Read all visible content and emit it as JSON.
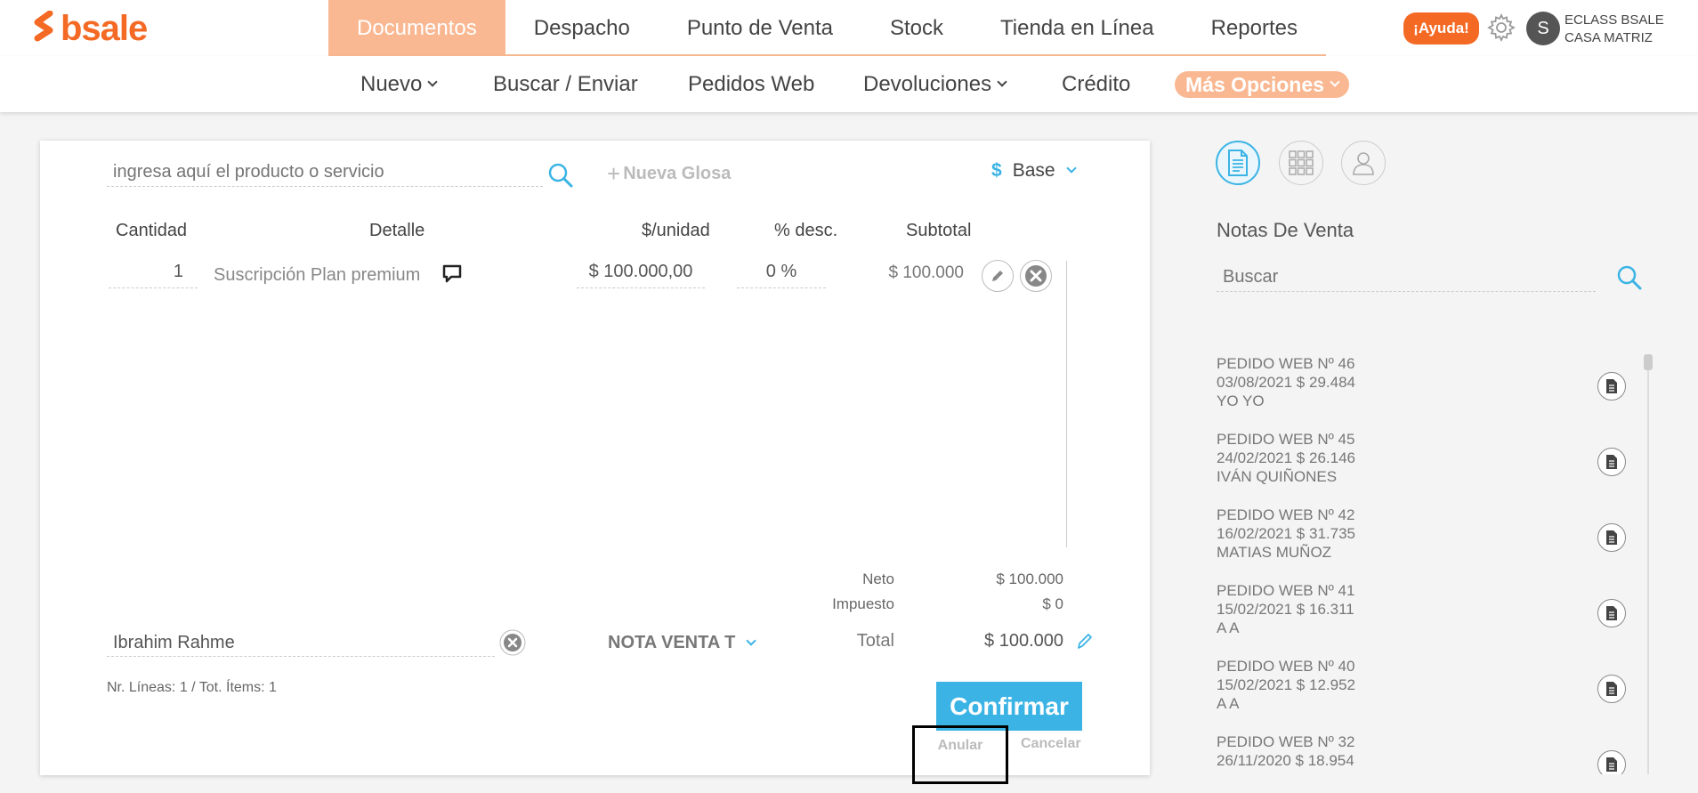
{
  "brand": {
    "name": "bsale",
    "color": "#f46a25"
  },
  "main_nav": {
    "items": [
      {
        "label": "Documentos",
        "active": true
      },
      {
        "label": "Despacho"
      },
      {
        "label": "Punto de Venta"
      },
      {
        "label": "Stock"
      },
      {
        "label": "Tienda en Línea"
      },
      {
        "label": "Reportes"
      }
    ],
    "help_label": "¡Ayuda!"
  },
  "user": {
    "initial": "S",
    "line1": "ECLASS BSALE",
    "line2": "CASA MATRIZ"
  },
  "sub_nav": {
    "items": [
      {
        "label": "Nuevo",
        "dropdown": true
      },
      {
        "label": "Buscar / Enviar"
      },
      {
        "label": "Pedidos Web"
      },
      {
        "label": "Devoluciones",
        "dropdown": true
      },
      {
        "label": "Crédito"
      }
    ],
    "more": {
      "label": "Más Opciones",
      "dropdown": true
    }
  },
  "document": {
    "search_placeholder": "ingresa aquí el producto o servicio",
    "nueva_glosa": "Nueva Glosa",
    "currency_symbol": "$",
    "currency_label": "Base",
    "columns": {
      "quantity": "Cantidad",
      "detail": "Detalle",
      "unit_price": "$/unidad",
      "discount": "% desc.",
      "subtotal": "Subtotal"
    },
    "lines": [
      {
        "quantity": "1",
        "detail": "Suscripción Plan premium",
        "unit_price": "$ 100.000,00",
        "discount": "0 %",
        "subtotal": "$ 100.000"
      }
    ],
    "totals": {
      "neto_label": "Neto",
      "neto": "$ 100.000",
      "impuesto_label": "Impuesto",
      "impuesto": "$ 0",
      "total_label": "Total",
      "total": "$ 100.000"
    },
    "client": "Ibrahim Rahme",
    "doc_type": "NOTA VENTA T",
    "line_count": "Nr. Líneas: 1 / Tot. Ítems: 1",
    "confirm": "Confirmar",
    "anular": "Anular",
    "cancelar": "Cancelar"
  },
  "side_panel": {
    "title": "Notas De Venta",
    "search_placeholder": "Buscar",
    "items": [
      {
        "line1": "PEDIDO WEB Nº 46",
        "line2": "03/08/2021 $ 29.484",
        "line3": "YO YO"
      },
      {
        "line1": "PEDIDO WEB Nº 45",
        "line2": "24/02/2021 $ 26.146",
        "line3": "IVÁN QUIÑONES"
      },
      {
        "line1": "PEDIDO WEB Nº 42",
        "line2": "16/02/2021 $ 31.735",
        "line3": "MATIAS MUÑOZ"
      },
      {
        "line1": "PEDIDO WEB Nº 41",
        "line2": "15/02/2021 $ 16.311",
        "line3": "A A"
      },
      {
        "line1": "PEDIDO WEB Nº 40",
        "line2": "15/02/2021 $ 12.952",
        "line3": "A A"
      },
      {
        "line1": "PEDIDO WEB Nº 32",
        "line2": "26/11/2020 $ 18.954",
        "line3": ""
      }
    ]
  },
  "colors": {
    "accent": "#3bb4e5",
    "brand": "#f46a25",
    "nav_active": "#f9b892"
  }
}
